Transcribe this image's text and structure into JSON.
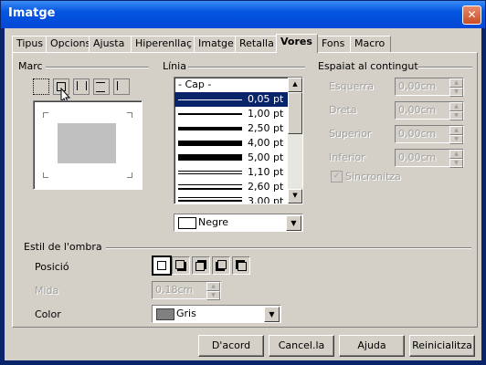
{
  "window": {
    "title": "Imatge",
    "close_glyph": "✕"
  },
  "tabs": [
    {
      "label": "Tipus"
    },
    {
      "label": "Opcions"
    },
    {
      "label": "Ajusta"
    },
    {
      "label": "Hiperenllaç"
    },
    {
      "label": "Imatge"
    },
    {
      "label": "Retalla"
    },
    {
      "label": "Vores",
      "active": true
    },
    {
      "label": "Fons"
    },
    {
      "label": "Macro"
    }
  ],
  "marc": {
    "label": "Marc"
  },
  "linia": {
    "label": "Línia",
    "items": [
      {
        "label": "- Cap -"
      },
      {
        "label": "0,05 pt"
      },
      {
        "label": "1,00 pt"
      },
      {
        "label": "2,50 pt"
      },
      {
        "label": "4,00 pt"
      },
      {
        "label": "5,00 pt"
      },
      {
        "label": "1,10 pt"
      },
      {
        "label": "2,60 pt"
      },
      {
        "label": "3,00 pt"
      }
    ],
    "selected": "0,05 pt",
    "color_label": "Negre",
    "color_hex": "#000000"
  },
  "espaiat": {
    "label": "Espaiat al contingut",
    "fields": [
      {
        "label": "Esquerra",
        "value": "0,00cm"
      },
      {
        "label": "Dreta",
        "value": "0,00cm"
      },
      {
        "label": "Superior",
        "value": "0,00cm"
      },
      {
        "label": "Inferior",
        "value": "0,00cm"
      }
    ],
    "sync_label": "Sincronitza",
    "sync_check": "✓"
  },
  "ombra": {
    "label": "Estil de l'ombra",
    "posicio_label": "Posició",
    "mida_label": "Mida",
    "mida_value": "0,18cm",
    "color_label": "Color",
    "color_value": "Gris",
    "color_hex": "#808080"
  },
  "buttons": {
    "ok": "D'acord",
    "cancel": "Cancel.la",
    "help": "Ajuda",
    "reset": "Reinicialitza"
  }
}
